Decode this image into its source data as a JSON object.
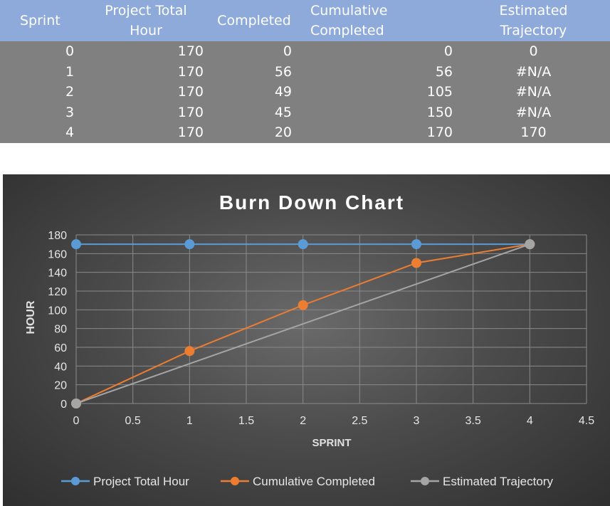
{
  "table": {
    "headers": [
      "Sprint",
      "Project Total\nHour",
      "Completed",
      "Cumulative\nCompleted",
      "Estimated\nTrajectory"
    ],
    "rows": [
      [
        "0",
        "170",
        "0",
        "0",
        "0"
      ],
      [
        "1",
        "170",
        "56",
        "56",
        "#N/A"
      ],
      [
        "2",
        "170",
        "49",
        "105",
        "#N/A"
      ],
      [
        "3",
        "170",
        "45",
        "150",
        "#N/A"
      ],
      [
        "4",
        "170",
        "20",
        "170",
        "170"
      ]
    ]
  },
  "chart_data": {
    "type": "line",
    "title": "Burn Down Chart",
    "xlabel": "SPRINT",
    "ylabel": "HOUR",
    "xlim": [
      0,
      4.5
    ],
    "ylim": [
      0,
      180
    ],
    "xticks": [
      "0",
      "0.5",
      "1",
      "1.5",
      "2",
      "2.5",
      "3",
      "3.5",
      "4",
      "4.5"
    ],
    "yticks": [
      "0",
      "20",
      "40",
      "60",
      "80",
      "100",
      "120",
      "140",
      "160",
      "180"
    ],
    "grid": true,
    "legend_position": "bottom",
    "series": [
      {
        "name": "Project Total Hour",
        "color": "#5b9bd5",
        "x": [
          0,
          1,
          2,
          3,
          4
        ],
        "y": [
          170,
          170,
          170,
          170,
          170
        ]
      },
      {
        "name": "Cumulative Completed",
        "color": "#ed7d31",
        "x": [
          0,
          1,
          2,
          3,
          4
        ],
        "y": [
          0,
          56,
          105,
          150,
          170
        ]
      },
      {
        "name": "Estimated Trajectory",
        "color": "#a5a5a5",
        "x": [
          0,
          4
        ],
        "y": [
          0,
          170
        ]
      }
    ]
  }
}
